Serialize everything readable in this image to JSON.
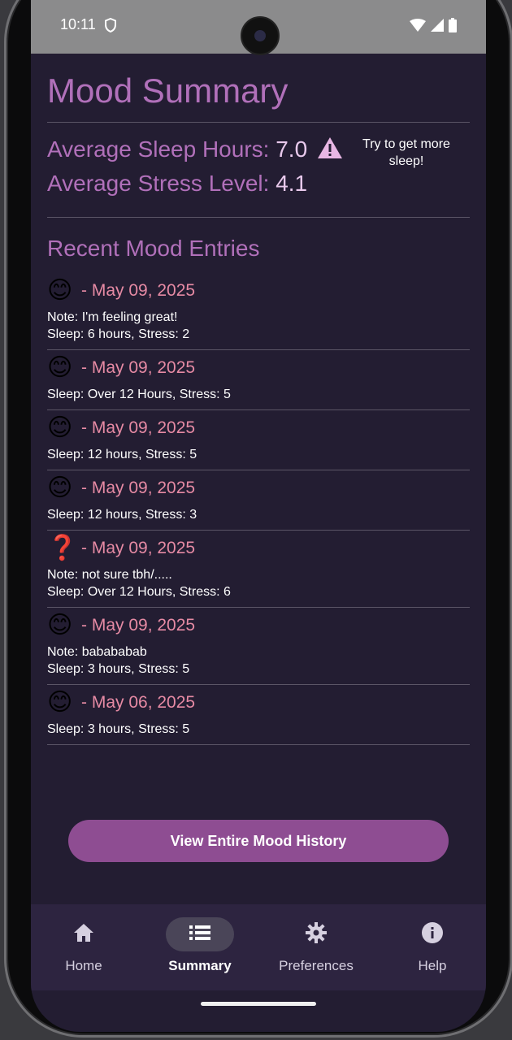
{
  "status_bar": {
    "time": "10:11"
  },
  "summary": {
    "title": "Mood Summary",
    "avg_sleep_label": "Average Sleep Hours:",
    "avg_sleep_value": "7.0",
    "avg_stress_label": "Average Stress Level:",
    "avg_stress_value": "4.1",
    "tip": "Try to get more sleep!"
  },
  "recent": {
    "title": "Recent Mood Entries",
    "entries": [
      {
        "emoji": "😊",
        "date": "- May 09, 2025",
        "note": "Note: I'm feeling great!",
        "details": "Sleep: 6 hours, Stress: 2"
      },
      {
        "emoji": "😊",
        "date": "- May 09, 2025",
        "note": "",
        "details": "Sleep: Over 12 Hours, Stress: 5"
      },
      {
        "emoji": "😊",
        "date": "- May 09, 2025",
        "note": "",
        "details": "Sleep: 12 hours, Stress: 5"
      },
      {
        "emoji": "😊",
        "date": "- May 09, 2025",
        "note": "",
        "details": "Sleep: 12 hours, Stress: 3"
      },
      {
        "emoji": "❓",
        "date": "- May 09, 2025",
        "note": "Note: not sure tbh/.....",
        "details": "Sleep: Over 12 Hours, Stress: 6"
      },
      {
        "emoji": "😊",
        "date": "- May 09, 2025",
        "note": "Note: babababab",
        "details": "Sleep: 3 hours, Stress: 5"
      },
      {
        "emoji": "😊",
        "date": "- May 06, 2025",
        "note": "",
        "details": "Sleep: 3 hours, Stress: 5"
      }
    ]
  },
  "history_button": "View Entire Mood History",
  "nav": {
    "items": [
      {
        "label": "Home",
        "icon": "home-icon",
        "active": false
      },
      {
        "label": "Summary",
        "icon": "list-icon",
        "active": true
      },
      {
        "label": "Preferences",
        "icon": "gear-icon",
        "active": false
      },
      {
        "label": "Help",
        "icon": "info-icon",
        "active": false
      }
    ]
  },
  "colors": {
    "accent": "#b170ba",
    "date": "#e68aa4",
    "background": "#231d32",
    "button": "#8e4d92"
  }
}
